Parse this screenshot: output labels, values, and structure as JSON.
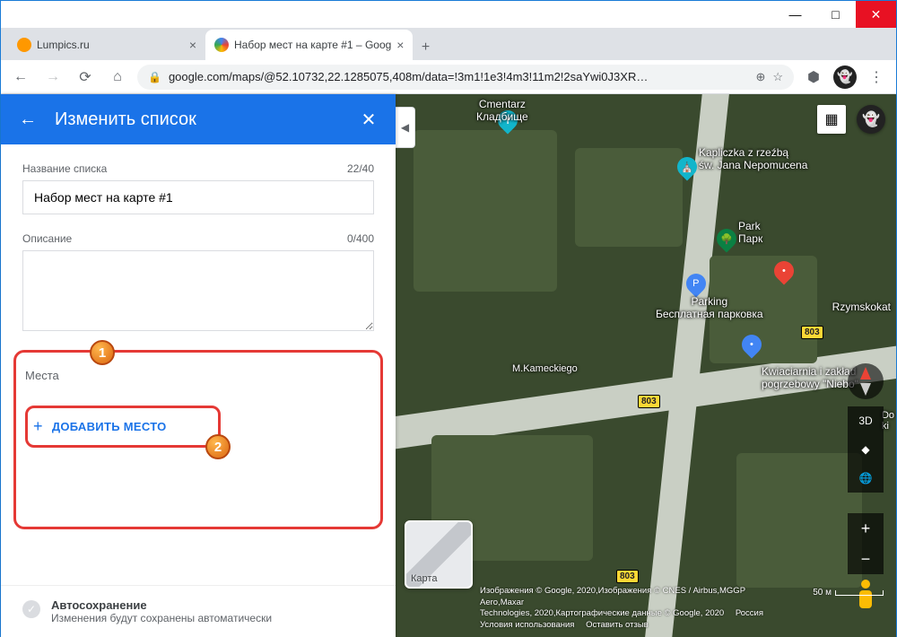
{
  "window": {
    "minimize": "—",
    "maximize": "□",
    "close": "✕"
  },
  "tabs": [
    {
      "title": "Lumpics.ru",
      "favcolor": "#ff9800",
      "active": false
    },
    {
      "title": "Набор мест на карте #1 – Goog",
      "favcolor": "#ea4335",
      "active": true
    }
  ],
  "omnibox": {
    "url": "google.com/maps/@52.10732,22.1285075,408m/data=!3m1!1e3!4m3!11m2!2saYwi0J3XR…"
  },
  "panel": {
    "title": "Изменить список",
    "name_label": "Название списка",
    "name_counter": "22/40",
    "name_value": "Набор мест на карте #1",
    "desc_label": "Описание",
    "desc_counter": "0/400",
    "desc_value": "",
    "places_label": "Места",
    "add_place": "ДОБАВИТЬ МЕСТО",
    "badge1": "1",
    "badge2": "2",
    "autosave_title": "Автосохранение",
    "autosave_sub": "Изменения будут сохранены автоматически"
  },
  "map": {
    "labels": {
      "cemetery": "Cmentarz\nКладбище",
      "chapel": "Kapliczka z rzeźbą\nśw. Jana Nepomucena",
      "park": "Park\nПарк",
      "parking": "Parking\nБесплатная парковка",
      "florist": "Kwiaciarnia i zakład\npogrzebowy \"Niebo\"",
      "town": "Rzymskokat",
      "street": "M.Kameckiego",
      "road": "803",
      "layer": "Карта",
      "scale": "50 м",
      "ctrl_3d": "3D",
      "ctrl_rot": "◆",
      "ctrl_globe": "🌐",
      "side": "Do\nki"
    },
    "attribution": {
      "line1": "Изображения © Google, 2020,Изображения © CNES / Airbus,MGGP Aero,Maxar",
      "line2a": "Technologies, 2020,Картографические данные © Google, 2020",
      "country": "Россия",
      "terms": "Условия использования",
      "feedback": "Оставить отзыв"
    }
  }
}
